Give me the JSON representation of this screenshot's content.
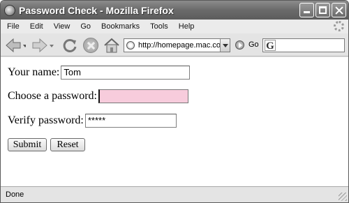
{
  "window": {
    "title": "Password Check - Mozilla Firefox"
  },
  "menu": {
    "items": [
      "File",
      "Edit",
      "View",
      "Go",
      "Bookmarks",
      "Tools",
      "Help"
    ]
  },
  "toolbar": {
    "url": "http://homepage.mac.com",
    "go_label": "Go",
    "search_engine_letter": "G"
  },
  "form": {
    "name_label": "Your name:",
    "name_value": "Tom",
    "password_label": "Choose a password:",
    "password_value": "",
    "verify_label": "Verify password:",
    "verify_value": "*****",
    "submit_label": "Submit",
    "reset_label": "Reset"
  },
  "colors": {
    "password_field_highlight": "#f7ccdc"
  },
  "status": {
    "text": "Done"
  }
}
